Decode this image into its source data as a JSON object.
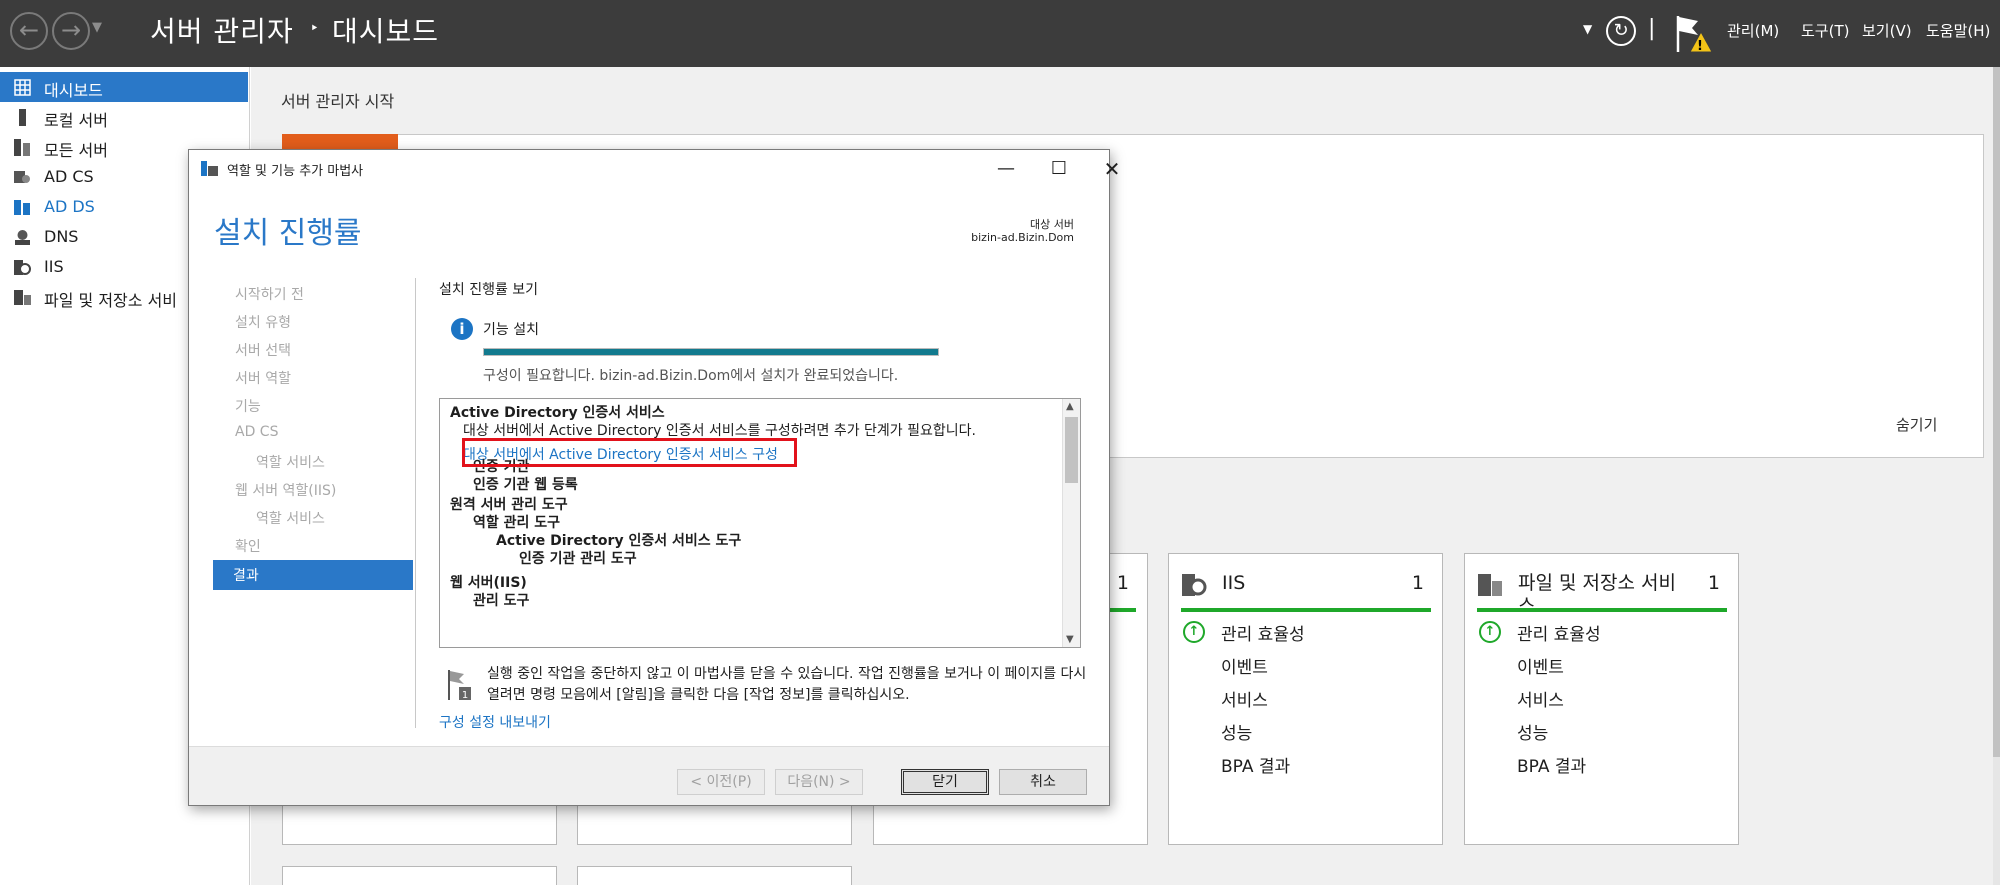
{
  "titlebar": {
    "app_title": "서버 관리자",
    "separator": "‣",
    "page": "대시보드",
    "menus": [
      "관리(M)",
      "도구(T)",
      "보기(V)",
      "도움말(H)"
    ]
  },
  "sidebar": {
    "items": [
      {
        "label": "대시보드",
        "icon": "grid-icon"
      },
      {
        "label": "로컬 서버",
        "icon": "server-icon"
      },
      {
        "label": "모든 서버",
        "icon": "servers-icon"
      },
      {
        "label": "AD CS",
        "icon": "certificate-icon"
      },
      {
        "label": "AD DS",
        "icon": "directory-icon"
      },
      {
        "label": "DNS",
        "icon": "dns-icon"
      },
      {
        "label": "IIS",
        "icon": "iis-icon"
      },
      {
        "label": "파일 및 저장소 서비",
        "icon": "storage-icon"
      }
    ]
  },
  "main": {
    "start_title": "서버 관리자 시작",
    "hide_label": "숨기기",
    "tiles": [
      {
        "title": "IIS",
        "count": "1",
        "rows": [
          "관리 효율성",
          "이벤트",
          "서비스",
          "성능",
          "BPA 결과"
        ]
      },
      {
        "title": "파일 및 저장소 서비스",
        "count": "1",
        "rows": [
          "관리 효율성",
          "이벤트",
          "서비스",
          "성능",
          "BPA 결과"
        ]
      }
    ],
    "partial_tile_count": "1"
  },
  "dialog": {
    "title": "역할 및 기능 추가 마법사",
    "heading": "설치 진행률",
    "target_label": "대상 서버",
    "target_server": "bizin-ad.Bizin.Dom",
    "steps": [
      "시작하기 전",
      "설치 유형",
      "서버 선택",
      "서버 역할",
      "기능",
      "AD CS",
      "역할 서비스",
      "웹 서버 역할(IIS)",
      "역할 서비스",
      "확인",
      "결과"
    ],
    "progress_heading": "설치 진행률 보기",
    "feature_install": "기능 설치",
    "progress": 1.0,
    "progress_status": "구성이 필요합니다. bizin-ad.Bizin.Dom에서 설치가 완료되었습니다.",
    "results": [
      "Active Directory 인증서 서비스",
      "대상 서버에서 Active Directory 인증서 서비스를 구성하려면 추가 단계가 필요합니다.",
      "대상 서버에서 Active Directory 인증서 서비스 구성",
      "인증 기관",
      "인증 기관 웹 등록",
      "원격 서버 관리 도구",
      "역할 관리 도구",
      "Active Directory 인증서 서비스 도구",
      "인증 기관 관리 도구",
      "웹 서버(IIS)",
      "관리 도구"
    ],
    "note": "실행 중인 작업을 중단하지 않고 이 마법사를 닫을 수 있습니다. 작업 진행률을 보거나 이 페이지를 다시 열려면 명령 모음에서 [알림]을 클릭한 다음 [작업 정보]를 클릭하십시오.",
    "export_link": "구성 설정 내보내기",
    "buttons": {
      "prev": "< 이전(P)",
      "next": "다음(N) >",
      "close": "닫기",
      "cancel": "취소"
    }
  },
  "colors": {
    "accent": "#2a78c8",
    "titlebar": "#3c3c3c",
    "highlight": "#e2121b",
    "status_green": "#1fa82a",
    "progress": "#127a8e",
    "orange": "#e25d1b"
  }
}
